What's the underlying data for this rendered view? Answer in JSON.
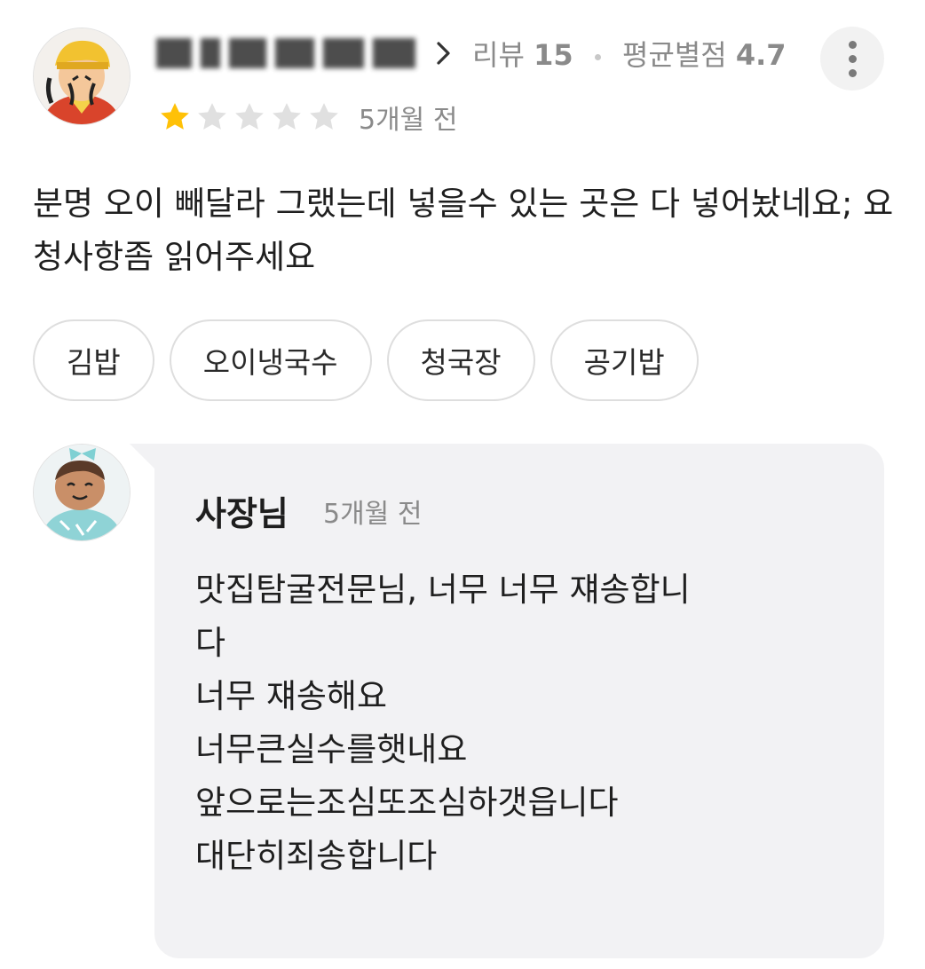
{
  "review": {
    "meta_reviews_label": "리뷰",
    "meta_reviews_count": "15",
    "meta_avg_label": "평균별점",
    "meta_avg_value": "4.7",
    "rating": 1,
    "rating_max": 5,
    "time": "5개월 전",
    "text": "분명 오이 빼달라 그랬는데 넣을수 있는 곳은 다 넣어놨네요; 요청사항좀 읽어주세요",
    "tags": [
      "김밥",
      "오이냉국수",
      "청국장",
      "공기밥"
    ]
  },
  "reply": {
    "author": "사장님",
    "time": "5개월 전",
    "lines": [
      "맛집탐굴전문님, 너무 너무 쟤송합니",
      "다",
      "너무 쟤송해요",
      "너무큰실수를햇내요",
      "앞으로는조심또조심하갯읍니다",
      "대단히죄송합니다"
    ]
  },
  "colors": {
    "star_filled": "#FFC107",
    "star_empty": "#E0E0E0",
    "muted_text": "#8A8A8A",
    "reply_bg": "#F2F2F4"
  }
}
